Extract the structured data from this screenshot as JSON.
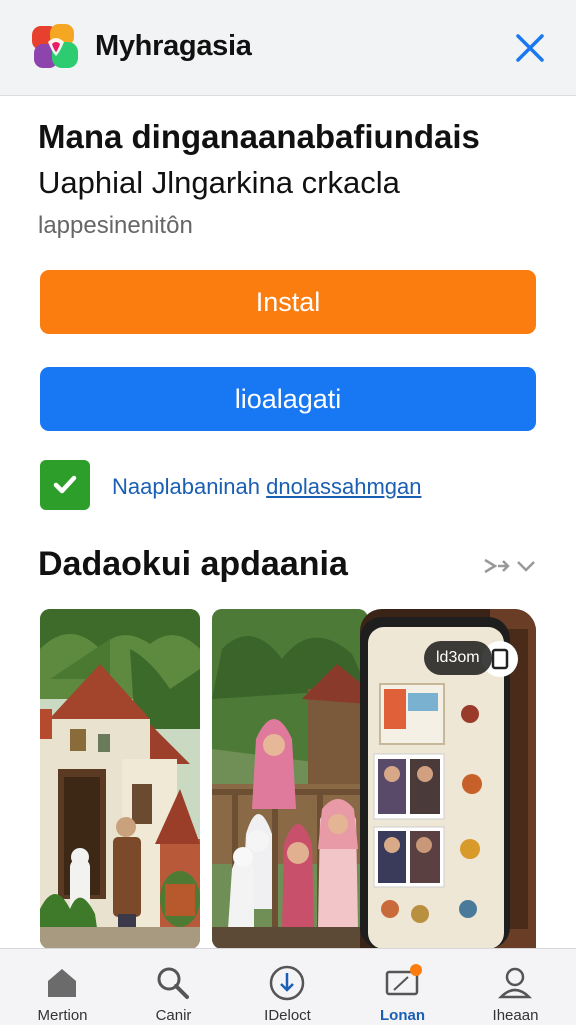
{
  "header": {
    "app_name": "Myhragasia",
    "logo_icon": "app-logo-icon",
    "close_icon": "close-icon",
    "accent": "#1877f2"
  },
  "listing": {
    "title": "Mana dinganaanabafiundais",
    "subtitle": "Uaphial Jlngarkina crkacla",
    "meta": "lappesinenitôn"
  },
  "buttons": {
    "install_label": "Instal",
    "install_color": "#fb7d0f",
    "secondary_label": "lioalagati",
    "secondary_color": "#1877f2"
  },
  "consent": {
    "checked": true,
    "label_prefix": "Naaplabaninah ",
    "label_link": "dnolassahmgan",
    "check_color": "#2e9e2b"
  },
  "screenshots_section": {
    "title": "Dadaokui apdaania",
    "more_icon": "chevron-right-down-icon",
    "badge_text": "ld3om"
  },
  "bottom_nav": {
    "items": [
      {
        "label": "Mertion",
        "icon": "home-icon"
      },
      {
        "label": "Canir",
        "icon": "search-icon"
      },
      {
        "label": "IDeloct",
        "icon": "download-icon"
      },
      {
        "label": "Lonan",
        "icon": "tablet-icon"
      },
      {
        "label": "Iheaan",
        "icon": "account-icon"
      }
    ],
    "active_index": 3
  }
}
